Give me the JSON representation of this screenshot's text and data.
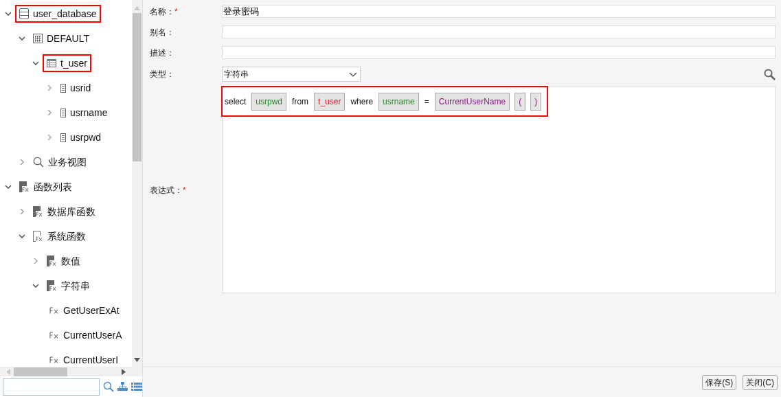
{
  "tree": [
    {
      "label": "user_database",
      "kind": "database",
      "expanded": true,
      "highlighted": true,
      "children": [
        {
          "label": "DEFAULT",
          "kind": "schema",
          "expanded": true,
          "highlighted": false,
          "children": [
            {
              "label": "t_user",
              "kind": "table",
              "expanded": true,
              "highlighted": true,
              "children": [
                {
                  "label": "usrid",
                  "kind": "column",
                  "expanded": false,
                  "highlighted": false
                },
                {
                  "label": "usrname",
                  "kind": "column",
                  "expanded": false,
                  "highlighted": false
                },
                {
                  "label": "usrpwd",
                  "kind": "column",
                  "expanded": false,
                  "highlighted": false
                }
              ]
            }
          ]
        },
        {
          "label": "业务视图",
          "kind": "view",
          "expanded": false,
          "highlighted": false
        }
      ]
    },
    {
      "label": "函数列表",
      "kind": "function-folder",
      "expanded": true,
      "highlighted": false,
      "children": [
        {
          "label": "数据库函数",
          "kind": "function-folder",
          "expanded": false,
          "highlighted": false
        },
        {
          "label": "系统函数",
          "kind": "function-folder-outline",
          "expanded": true,
          "highlighted": false,
          "children": [
            {
              "label": "数值",
              "kind": "function-folder",
              "expanded": false,
              "highlighted": false
            },
            {
              "label": "字符串",
              "kind": "function-folder",
              "expanded": true,
              "highlighted": false,
              "children": [
                {
                  "label": "GetUserExAt",
                  "kind": "function"
                },
                {
                  "label": "CurrentUserA",
                  "kind": "function"
                },
                {
                  "label": "CurrentUserI",
                  "kind": "function"
                }
              ]
            }
          ]
        }
      ]
    }
  ],
  "fields": [
    {
      "label": "名称：",
      "marker": "*",
      "kind": "text",
      "value": "登录密码"
    },
    {
      "label": "别名：",
      "kind": "text"
    },
    {
      "label": "描述：",
      "kind": "text"
    },
    {
      "label": "类型：",
      "kind": "select",
      "value": "字符串"
    }
  ],
  "expression": {
    "label": "表达式：",
    "marker": "*",
    "highlighted": true,
    "tokens": [
      {
        "text": "select",
        "kind": "keyword"
      },
      {
        "text": "usrpwd",
        "kind": "field"
      },
      {
        "text": "from",
        "kind": "keyword"
      },
      {
        "text": "t_user",
        "kind": "table"
      },
      {
        "text": "where",
        "kind": "keyword"
      },
      {
        "text": "usrname",
        "kind": "field"
      },
      {
        "text": "=",
        "kind": "keyword"
      },
      {
        "text": "CurrentUserName",
        "kind": "function"
      },
      {
        "text": "(",
        "kind": "paren"
      },
      {
        "text": ")",
        "kind": "paren"
      }
    ]
  },
  "buttons": [
    "保存(S)",
    "关闭(C)"
  ]
}
